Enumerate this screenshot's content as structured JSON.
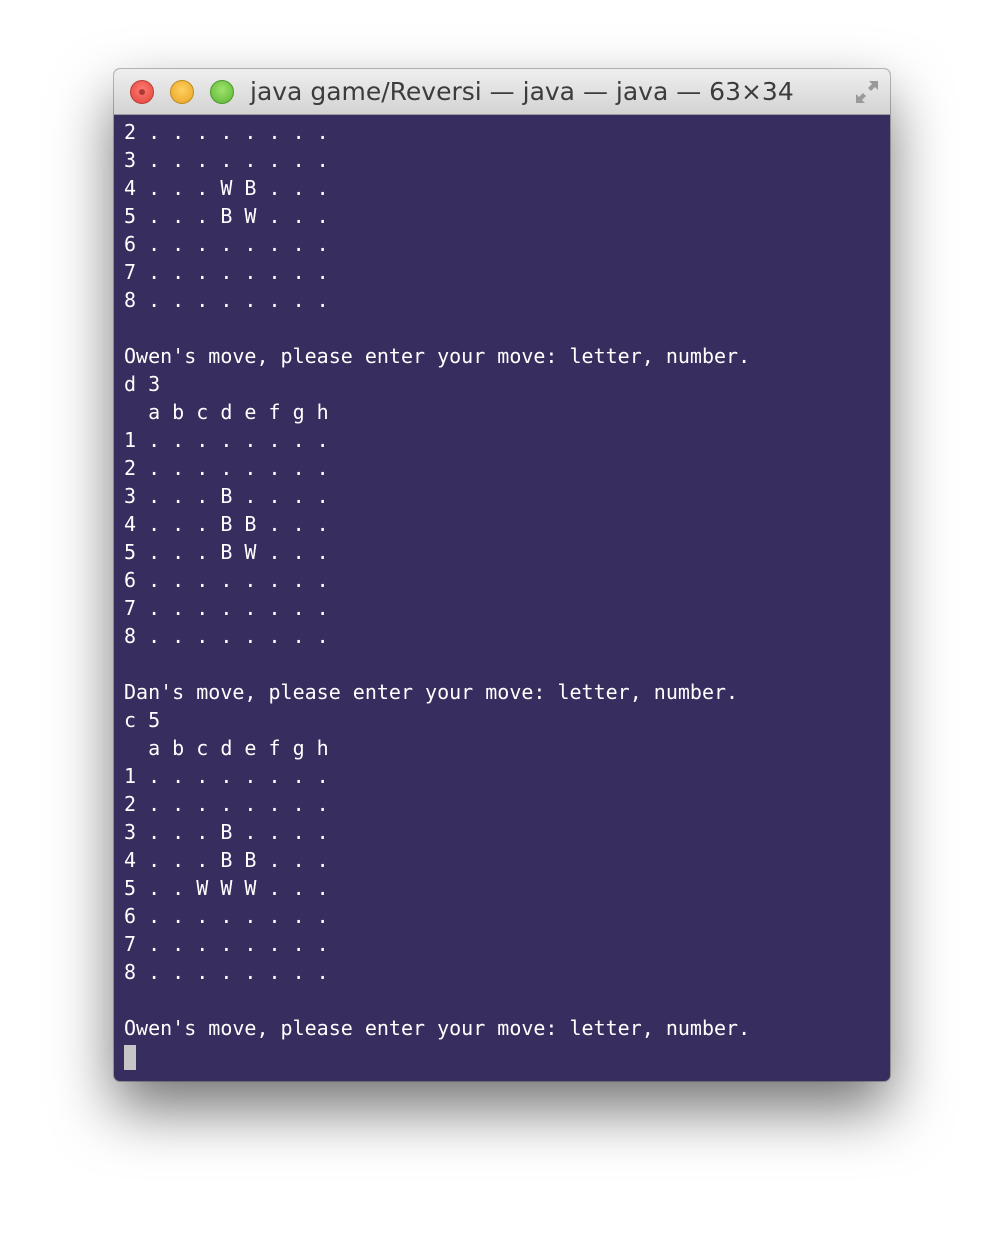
{
  "window": {
    "title": "java game/Reversi — java — java — 63×34"
  },
  "terminal": {
    "lines": [
      "2 . . . . . . . .",
      "3 . . . . . . . .",
      "4 . . . W B . . .",
      "5 . . . B W . . .",
      "6 . . . . . . . .",
      "7 . . . . . . . .",
      "8 . . . . . . . .",
      "",
      "Owen's move, please enter your move: letter, number.",
      "d 3",
      "  a b c d e f g h",
      "1 . . . . . . . .",
      "2 . . . . . . . .",
      "3 . . . B . . . .",
      "4 . . . B B . . .",
      "5 . . . B W . . .",
      "6 . . . . . . . .",
      "7 . . . . . . . .",
      "8 . . . . . . . .",
      "",
      "Dan's move, please enter your move: letter, number.",
      "c 5",
      "  a b c d e f g h",
      "1 . . . . . . . .",
      "2 . . . . . . . .",
      "3 . . . B . . . .",
      "4 . . . B B . . .",
      "5 . . W W W . . .",
      "6 . . . . . . . .",
      "7 . . . . . . . .",
      "8 . . . . . . . .",
      "",
      "Owen's move, please enter your move: letter, number."
    ]
  },
  "colors": {
    "terminal_background": "#372d5e",
    "terminal_text": "#ffffff",
    "cursor": "#c6c6c6"
  },
  "icons": {
    "close": "close-icon",
    "minimize": "minimize-icon",
    "zoom": "zoom-icon",
    "fullscreen": "fullscreen-icon"
  }
}
